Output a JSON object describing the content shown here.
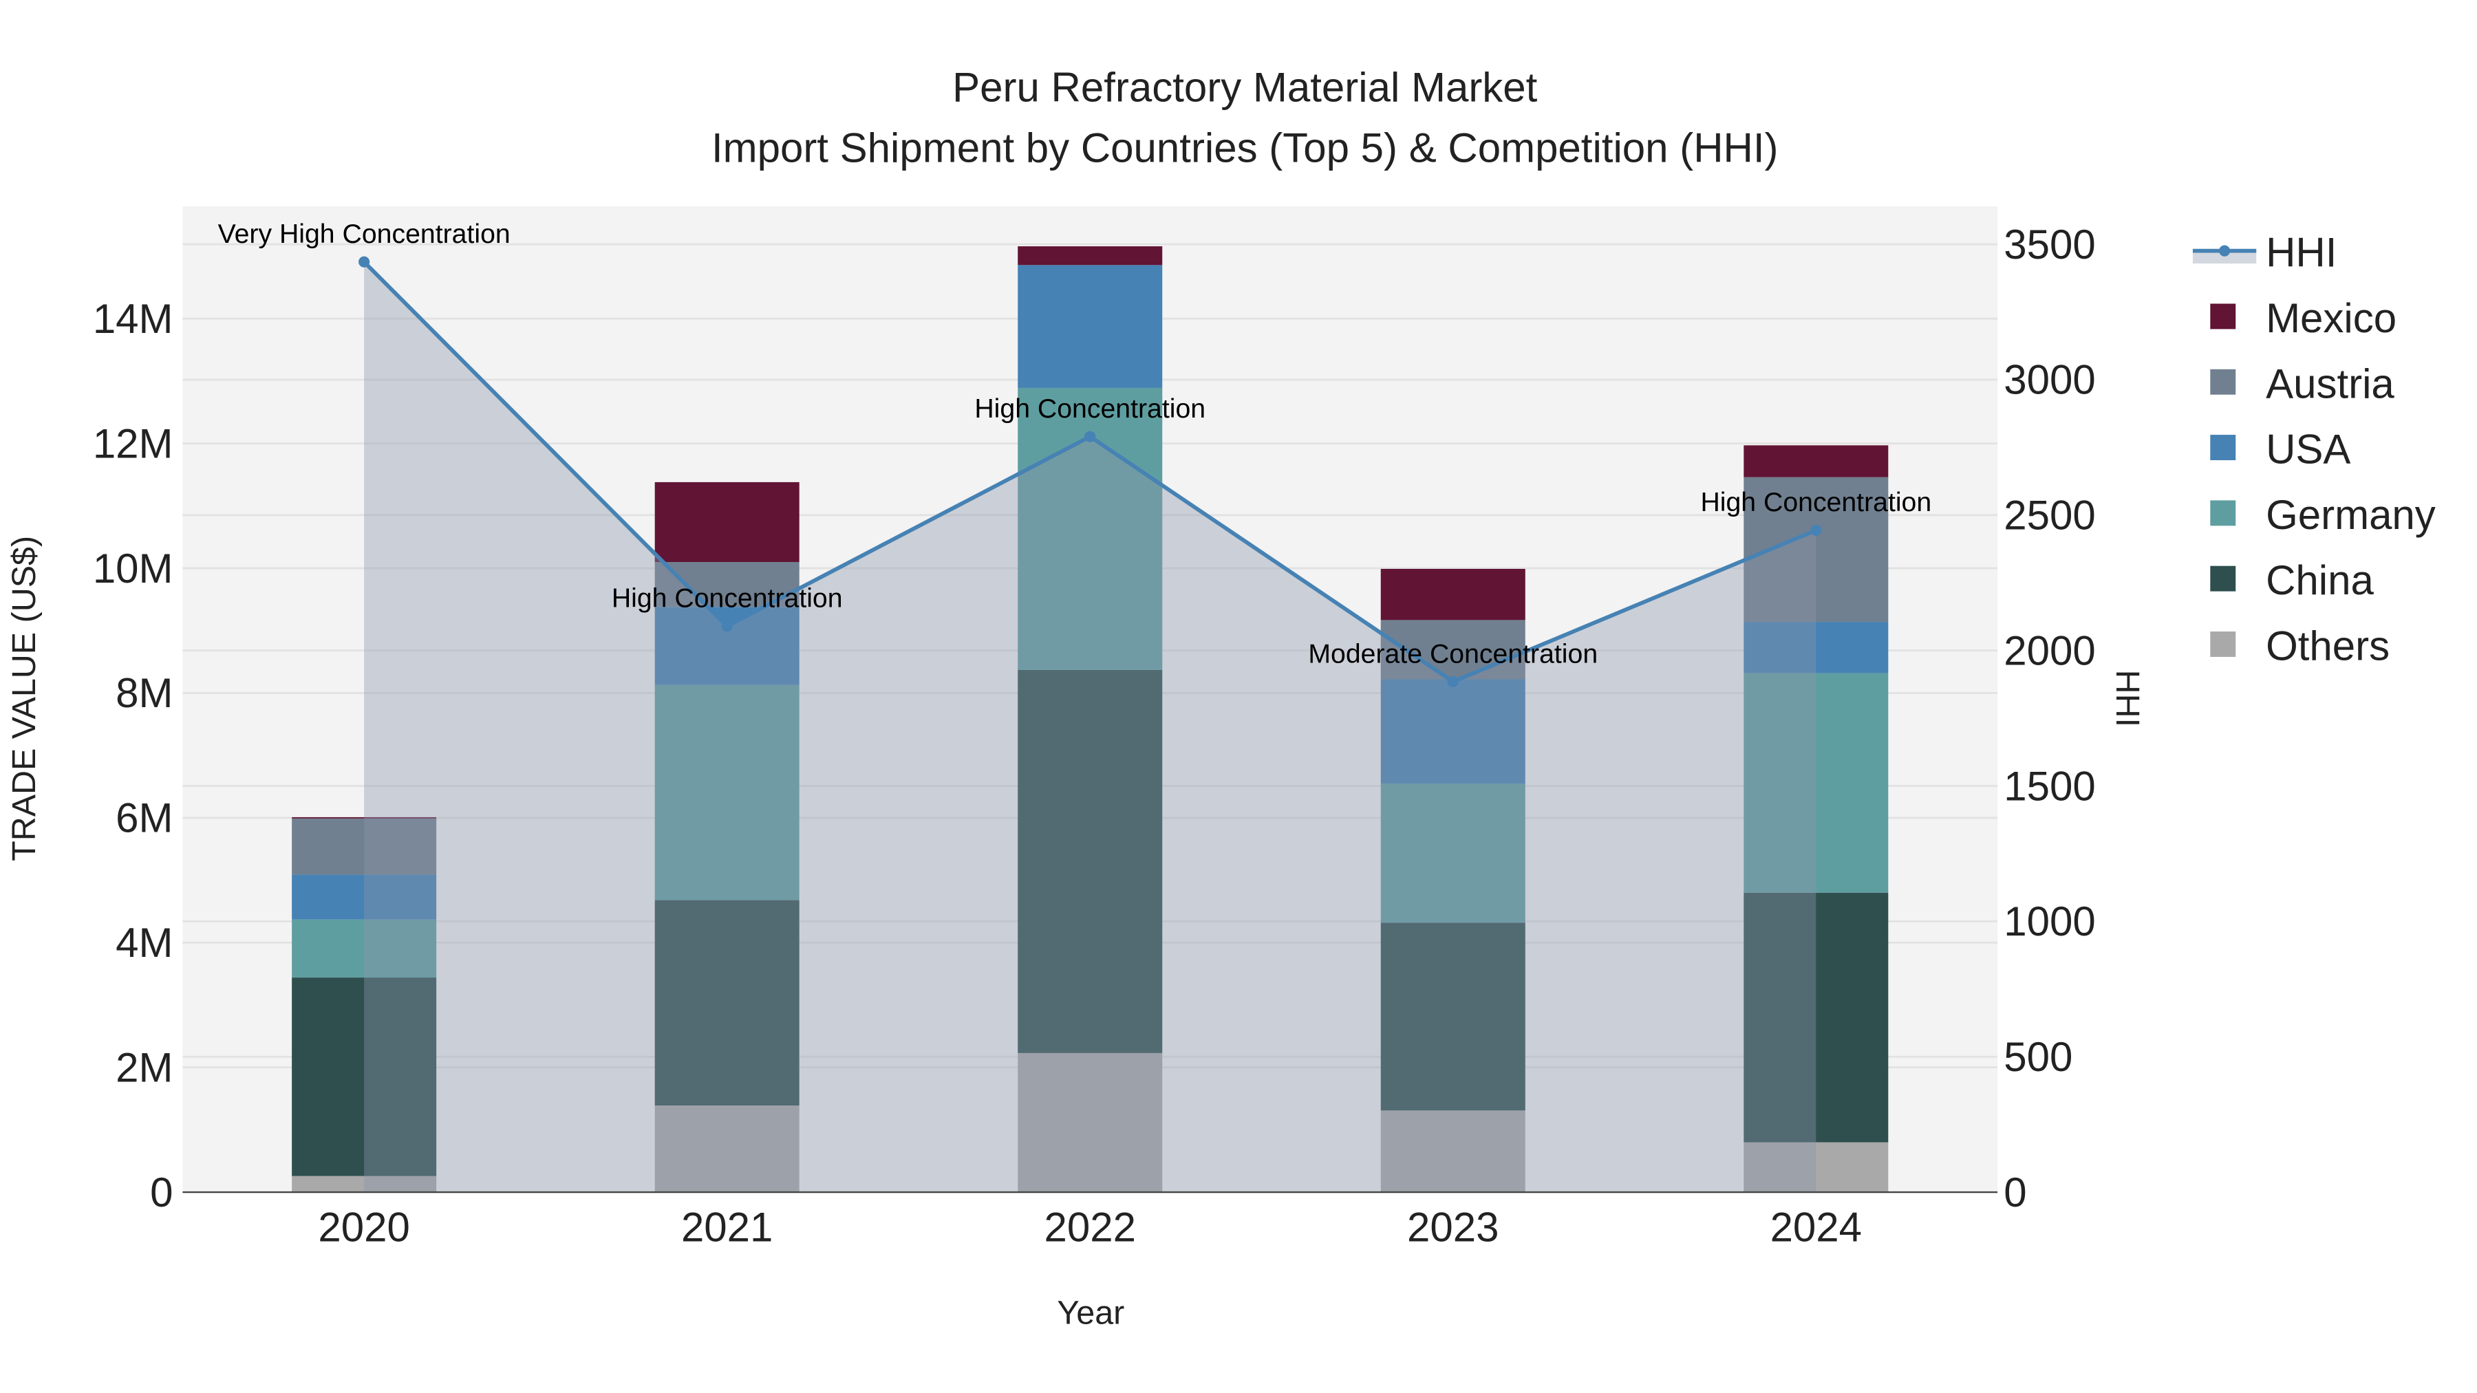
{
  "chart_data": {
    "type": "bar",
    "stacked": true,
    "title": "Peru Refractory Material Market",
    "subtitle": "Import Shipment by Countries (Top 5) & Competition (HHI)",
    "xlabel": "Year",
    "ylabel": "TRADE VALUE (US$)",
    "y2label": "HHI",
    "categories": [
      "2020",
      "2021",
      "2022",
      "2023",
      "2024"
    ],
    "ylim": [
      0,
      15800000
    ],
    "yticks": [
      0,
      2000000,
      4000000,
      6000000,
      8000000,
      10000000,
      12000000,
      14000000
    ],
    "ytick_labels": [
      "0",
      "2M",
      "4M",
      "6M",
      "8M",
      "10M",
      "12M",
      "14M"
    ],
    "y2lim": [
      0,
      3640
    ],
    "y2ticks": [
      0,
      500,
      1000,
      1500,
      2000,
      2500,
      3000,
      3500
    ],
    "y2tick_labels": [
      "0",
      "500",
      "1000",
      "1500",
      "2000",
      "2500",
      "3000",
      "3500"
    ],
    "grid": true,
    "legend_placement": "right",
    "series": [
      {
        "name": "Others",
        "color": "#a9a9a9",
        "values": [
          260000,
          1390000,
          2230000,
          1310000,
          800000
        ]
      },
      {
        "name": "China",
        "color": "#2f4f4f",
        "values": [
          3180000,
          3290000,
          6140000,
          3010000,
          4000000
        ]
      },
      {
        "name": "Germany",
        "color": "#5f9ea0",
        "values": [
          930000,
          3450000,
          4520000,
          2230000,
          3520000
        ]
      },
      {
        "name": "USA",
        "color": "#4682b4",
        "values": [
          720000,
          1250000,
          1970000,
          1670000,
          820000
        ]
      },
      {
        "name": "Austria",
        "color": "#708090",
        "values": [
          900000,
          720000,
          0,
          950000,
          2320000
        ]
      },
      {
        "name": "Mexico",
        "color": "#611434",
        "values": [
          20000,
          1280000,
          300000,
          820000,
          510000
        ]
      }
    ],
    "hhi": {
      "name": "HHI",
      "color": "#4682b4",
      "values": [
        3435,
        2090,
        2790,
        1885,
        2444
      ],
      "annotations": [
        "Very High Concentration",
        "High Concentration",
        "High Concentration",
        "Moderate Concentration",
        "High Concentration"
      ]
    },
    "legend_order": [
      "HHI",
      "Mexico",
      "Austria",
      "USA",
      "Germany",
      "China",
      "Others"
    ]
  }
}
